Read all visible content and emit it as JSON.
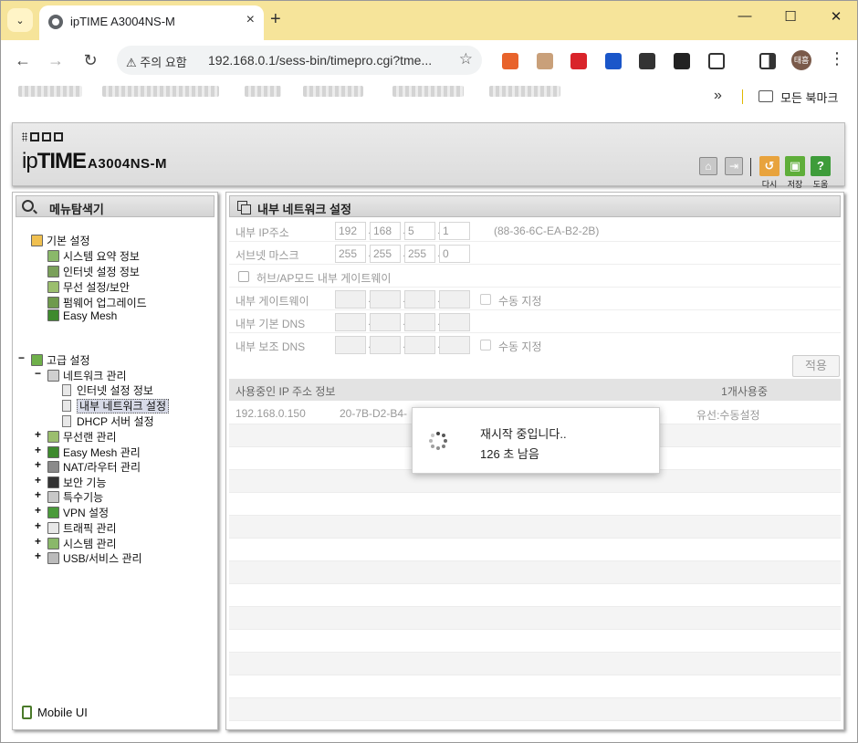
{
  "browser": {
    "tab_title": "ipTIME A3004NS-M",
    "security_label": "주의 요함",
    "url": "192.168.0.1/sess-bin/timepro.cgi?tme...",
    "avatar_text": "태흠",
    "bookmarks_folder": "모든 북마크",
    "ext_colors": [
      "#e8632b",
      "#c9a07a",
      "#d9242a",
      "#1a56c9",
      "#333333",
      "#222222"
    ]
  },
  "router": {
    "brand": "ipTIME",
    "model": "A3004NS-M",
    "buttons": [
      {
        "label": "다시",
        "color": "#e8a33d"
      },
      {
        "label": "저장",
        "color": "#5fae3a"
      },
      {
        "label": "도움",
        "color": "#3e9c3a",
        "glyph": "?"
      }
    ]
  },
  "menu": {
    "title": "메뉴탐색기",
    "basic": {
      "label": "기본 설정",
      "items": [
        "시스템 요약 정보",
        "인터넷 설정 정보",
        "무선 설정/보안",
        "펌웨어 업그레이드",
        "Easy Mesh"
      ]
    },
    "advanced": {
      "label": "고급 설정",
      "network": {
        "label": "네트워크 관리",
        "items": [
          "인터넷 설정 정보",
          "내부 네트워크 설정",
          "DHCP 서버 설정"
        ]
      },
      "items": [
        "무선랜 관리",
        "Easy Mesh 관리",
        "NAT/라우터 관리",
        "보안 기능",
        "특수기능",
        "VPN 설정",
        "트래픽 관리",
        "시스템 관리",
        "USB/서비스 관리"
      ]
    },
    "mobile": "Mobile UI"
  },
  "main": {
    "title": "내부 네트워크 설정",
    "ip_label": "내부 IP주소",
    "ip": [
      "192",
      "168",
      "5",
      "1"
    ],
    "mac": "(88-36-6C-EA-B2-2B)",
    "subnet_label": "서브넷 마스크",
    "subnet": [
      "255",
      "255",
      "255",
      "0"
    ],
    "hub_ap_label": "허브/AP모드 내부 게이트웨이",
    "gateway_label": "내부 게이트웨이",
    "manual_label": "수동 지정",
    "dns1_label": "내부 기본 DNS",
    "dns2_label": "내부 보조 DNS",
    "apply": "적용",
    "ip_info_title": "사용중인 IP 주소 정보",
    "ip_info_count": "1개사용중",
    "rows": [
      {
        "ip": "192.168.0.150",
        "mac": "20-7B-D2-B4-",
        "type": "유선:수동설정"
      }
    ]
  },
  "overlay": {
    "message": "재시작 중입니다..",
    "remaining": "126 초 남음"
  }
}
